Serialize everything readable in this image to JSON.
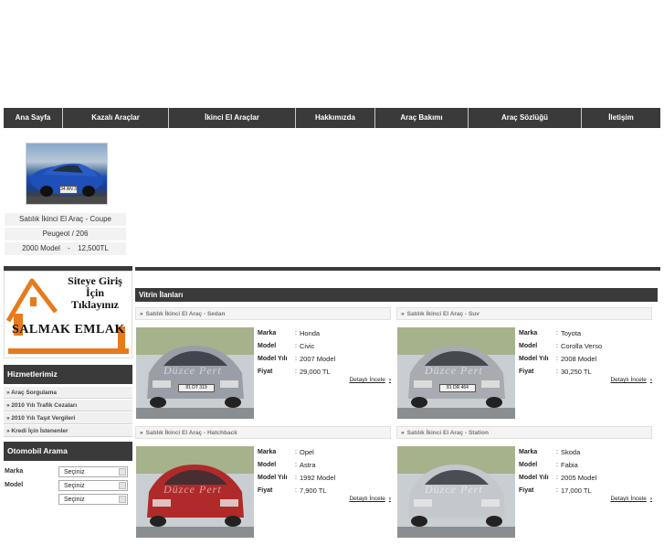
{
  "nav": [
    {
      "label": "Ana Sayfa"
    },
    {
      "label": "Kazalı Araçlar"
    },
    {
      "label": "İkinci El Araçlar"
    },
    {
      "label": "Hakkımızda"
    },
    {
      "label": "Araç Bakımı"
    },
    {
      "label": "Araç Sözlüğü"
    },
    {
      "label": "İletişim"
    }
  ],
  "featured": {
    "line1": "Satılık İkinci El Araç - Coupe",
    "line2": "Peugeot / 206",
    "model_year": "2000 Model",
    "dash": "-",
    "price": "12,500TL",
    "plate": "34 AN 3"
  },
  "banner": {
    "title_line1": "Siteye Giriş",
    "title_line2": "İçin",
    "title_line3": "Tıklayınız",
    "brand": "SALMAK EMLAK"
  },
  "services": {
    "heading": "Hizmetlerimiz",
    "items": [
      {
        "label": "» Araç Sorgulama"
      },
      {
        "label": "» 2010 Yılı Trafik Cezaları"
      },
      {
        "label": "» 2010 Yılı Taşıt Vergileri"
      },
      {
        "label": "» Kredi İçin İstenenler"
      }
    ]
  },
  "search": {
    "heading": "Otomobil Arama",
    "fields": [
      {
        "label": "Marka",
        "value": "Seçiniz"
      },
      {
        "label": "Model",
        "value": "Seçiniz"
      },
      {
        "label": "",
        "value": "Seçiniz"
      }
    ]
  },
  "vitrin": {
    "heading": "Vitrin İlanları",
    "spec_labels": {
      "brand": "Marka",
      "model": "Model",
      "year": "Model Yılı",
      "price": "Fiyat"
    },
    "colon": ":",
    "detail_label": "Detaylı İncele",
    "watermark": "Düzce Pert",
    "cards": [
      {
        "title": "Satılık İkinci El Araç - Sedan",
        "brand": "Honda",
        "model": "Civic",
        "year": "2007 Model",
        "price": "29,000 TL",
        "plate": "81 DT 319",
        "color": "#9a9ea6"
      },
      {
        "title": "Satılık İkinci El Araç - Suv",
        "brand": "Toyota",
        "model": "Corolla Verso",
        "year": "2008 Model",
        "price": "30,250 TL",
        "plate": "81 DR 464",
        "color": "#a8acb0"
      },
      {
        "title": "Satılık İkinci El Araç - Hatchback",
        "brand": "Opel",
        "model": "Astra",
        "year": "1992 Model",
        "price": "7,900 TL",
        "plate": "",
        "color": "#b02a2a"
      },
      {
        "title": "Satılık İkinci El Araç - Station",
        "brand": "Skoda",
        "model": "Fabia",
        "year": "2005 Model",
        "price": "17,000 TL",
        "plate": "",
        "color": "#c4c8cc"
      }
    ]
  },
  "colors": {
    "dark": "#3a3a3a",
    "accent": "#ffffff"
  }
}
